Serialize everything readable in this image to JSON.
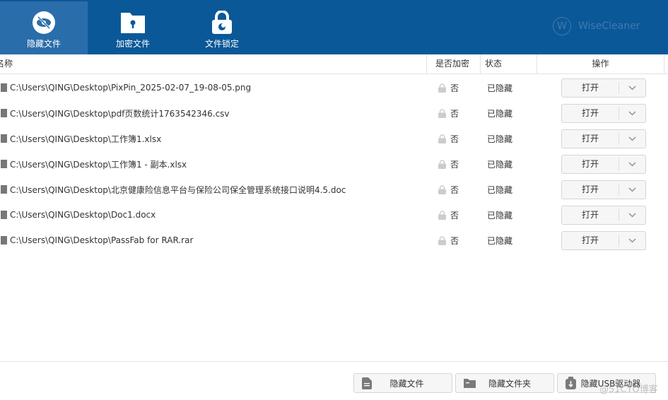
{
  "tabs": [
    {
      "label": "隐藏文件",
      "icon": "eye-slash-icon",
      "active": true
    },
    {
      "label": "加密文件",
      "icon": "folder-lock-icon"
    },
    {
      "label": "文件锁定",
      "icon": "padlock-icon"
    }
  ],
  "brand": {
    "logo_letter": "W",
    "name": "WiseCleaner"
  },
  "columns": {
    "name": "名称",
    "encrypted": "是否加密",
    "status": "状态",
    "action": "操作"
  },
  "rows": [
    {
      "path": "C:\\Users\\QING\\Desktop\\PixPin_2025-02-07_19-08-05.png",
      "encrypted": "否",
      "status": "已隐藏",
      "action": "打开"
    },
    {
      "path": "C:\\Users\\QING\\Desktop\\pdf页数统计1763542346.csv",
      "encrypted": "否",
      "status": "已隐藏",
      "action": "打开"
    },
    {
      "path": "C:\\Users\\QING\\Desktop\\工作簿1.xlsx",
      "encrypted": "否",
      "status": "已隐藏",
      "action": "打开"
    },
    {
      "path": "C:\\Users\\QING\\Desktop\\工作簿1 - 副本.xlsx",
      "encrypted": "否",
      "status": "已隐藏",
      "action": "打开"
    },
    {
      "path": "C:\\Users\\QING\\Desktop\\北京健康险信息平台与保险公司保全管理系统接口说明4.5.doc",
      "encrypted": "否",
      "status": "已隐藏",
      "action": "打开"
    },
    {
      "path": "C:\\Users\\QING\\Desktop\\Doc1.docx",
      "encrypted": "否",
      "status": "已隐藏",
      "action": "打开"
    },
    {
      "path": "C:\\Users\\QING\\Desktop\\PassFab for RAR.rar",
      "encrypted": "否",
      "status": "已隐藏",
      "action": "打开"
    }
  ],
  "bottom": {
    "hide_file": "隐藏文件",
    "hide_folder": "隐藏文件夹",
    "hide_usb": "隐藏USB驱动器"
  },
  "watermark": "@51CTO博客"
}
